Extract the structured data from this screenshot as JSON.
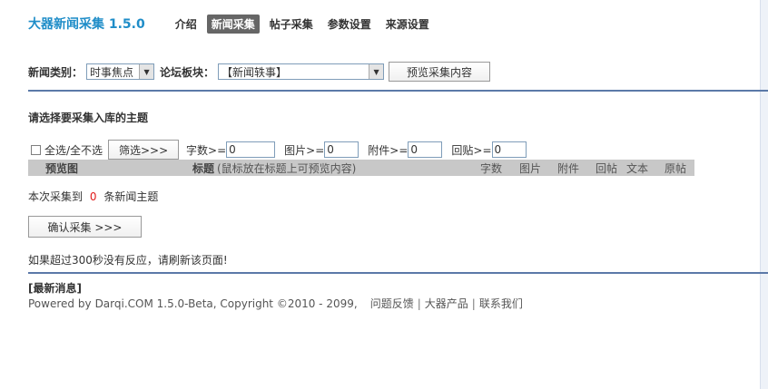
{
  "header": {
    "app_title": "大器新闻采集 1.5.0",
    "nav": [
      {
        "label": "介绍",
        "active": false
      },
      {
        "label": "新闻采集",
        "active": true
      },
      {
        "label": "帖子采集",
        "active": false
      },
      {
        "label": "参数设置",
        "active": false
      },
      {
        "label": "来源设置",
        "active": false
      }
    ]
  },
  "filters": {
    "category_label": "新闻类别：",
    "category_value": "时事焦点",
    "forum_label": "论坛板块：",
    "forum_value": "【新闻轶事】",
    "preview_button": "预览采集内容"
  },
  "selection": {
    "title": "请选择要采集入库的主题",
    "select_all_label": "全选/全不选",
    "filter_button": "筛选>>>",
    "criteria": [
      {
        "label": "字数>=",
        "value": "0"
      },
      {
        "label": "图片>=",
        "value": "0"
      },
      {
        "label": "附件>=",
        "value": "0"
      },
      {
        "label": "回贴>=",
        "value": "0"
      }
    ]
  },
  "table": {
    "headers": {
      "preview": "预览图",
      "title": "标题",
      "title_hint": "(鼠标放在标题上可预览内容)",
      "words": "字数",
      "images": "图片",
      "attachments": "附件",
      "replies": "回帖",
      "text": "文本",
      "source": "原帖"
    }
  },
  "result": {
    "prefix": "本次采集到",
    "count": "0",
    "suffix": "条新闻主题"
  },
  "confirm_button": "确认采集 >>>",
  "timeout_note": "如果超过300秒没有反应，请刷新该页面!",
  "news_label": "[最新消息]",
  "footer": {
    "powered_prefix": "Powered by",
    "brand": "Darqi.COM 1.5.0-Beta",
    "copyright": ", Copyright ©2010 - 2099,",
    "links": [
      "问题反馈",
      "大器产品",
      "联系我们"
    ]
  },
  "colors": {
    "title_blue": "#1f8dc8",
    "active_tab_bg": "#666666",
    "divider": "#5b79a8",
    "table_header_bg": "#c8c8c8",
    "count_red": "#e11a1a"
  }
}
